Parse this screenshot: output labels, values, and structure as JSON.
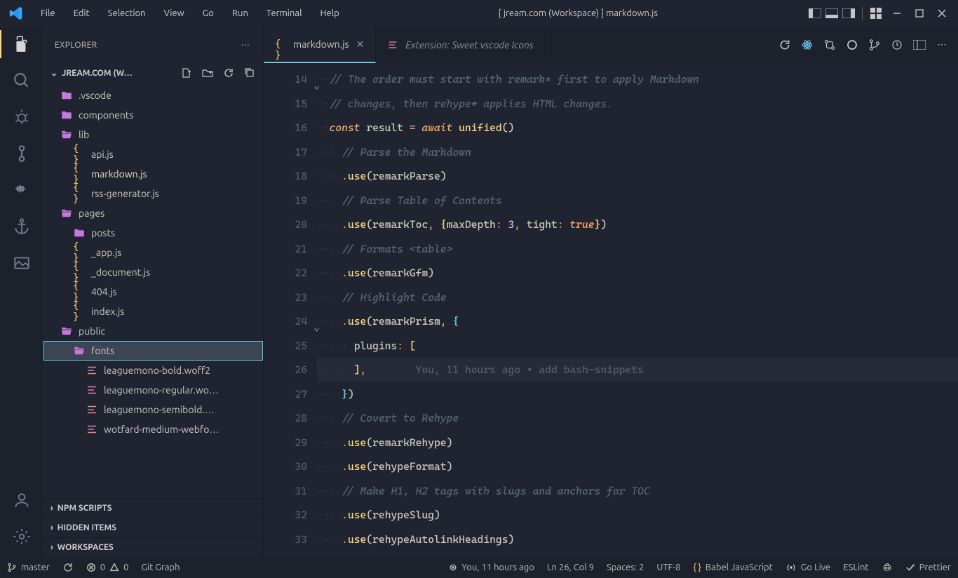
{
  "menu": [
    "File",
    "Edit",
    "Selection",
    "View",
    "Go",
    "Run",
    "Terminal",
    "Help"
  ],
  "window_title": "[ jream.com (Workspace) ] markdown.js",
  "sidebar": {
    "title": "EXPLORER",
    "workspace": "JREAM.COM (W…",
    "panels": [
      "NPM SCRIPTS",
      "HIDDEN ITEMS",
      "WORKSPACES"
    ]
  },
  "tree": [
    {
      "type": "folder",
      "depth": 0,
      "label": ".vscode",
      "open": false
    },
    {
      "type": "folder",
      "depth": 0,
      "label": "components",
      "open": false
    },
    {
      "type": "folder",
      "depth": 0,
      "label": "lib",
      "open": true
    },
    {
      "type": "file",
      "depth": 1,
      "label": "api.js",
      "kind": "js"
    },
    {
      "type": "file",
      "depth": 1,
      "label": "markdown.js",
      "kind": "js",
      "active": true
    },
    {
      "type": "file",
      "depth": 1,
      "label": "rss-generator.js",
      "kind": "js"
    },
    {
      "type": "folder",
      "depth": 0,
      "label": "pages",
      "open": true
    },
    {
      "type": "folder",
      "depth": 1,
      "label": "posts",
      "open": false
    },
    {
      "type": "file",
      "depth": 1,
      "label": "_app.js",
      "kind": "js"
    },
    {
      "type": "file",
      "depth": 1,
      "label": "_document.js",
      "kind": "js"
    },
    {
      "type": "file",
      "depth": 1,
      "label": "404.js",
      "kind": "js"
    },
    {
      "type": "file",
      "depth": 1,
      "label": "index.js",
      "kind": "js"
    },
    {
      "type": "folder",
      "depth": 0,
      "label": "public",
      "open": true
    },
    {
      "type": "folder",
      "depth": 1,
      "label": "fonts",
      "open": true,
      "selected": true
    },
    {
      "type": "file",
      "depth": 2,
      "label": "leaguemono-bold.woff2",
      "kind": "font"
    },
    {
      "type": "file",
      "depth": 2,
      "label": "leaguemono-regular.wo…",
      "kind": "font"
    },
    {
      "type": "file",
      "depth": 2,
      "label": "leaguemono-semibold.…",
      "kind": "font"
    },
    {
      "type": "file",
      "depth": 2,
      "label": "wotfard-medium-webfo…",
      "kind": "font"
    }
  ],
  "tabs": [
    {
      "label": "markdown.js",
      "kind": "js",
      "active": true,
      "pinned": false
    },
    {
      "label": "Extension: Sweet vscode Icons",
      "kind": "ext",
      "active": false
    }
  ],
  "code_start_line": 14,
  "code": {
    "blame_inline": "You, 11 hours ago • add bash-snippets",
    "lines": [
      {
        "n": 14,
        "fold": true,
        "t": [
          [
            "ws",
            "··"
          ],
          [
            "cm",
            "// The order must start with remark* first to apply Markdown"
          ]
        ]
      },
      {
        "n": 15,
        "t": [
          [
            "ws",
            "··"
          ],
          [
            "cm",
            "// changes, then rehype* applies HTML changes."
          ]
        ]
      },
      {
        "n": 16,
        "t": [
          [
            "ws",
            "··"
          ],
          [
            "kw",
            "const "
          ],
          [
            "var",
            "result "
          ],
          [
            "op",
            "= "
          ],
          [
            "kw",
            "await "
          ],
          [
            "fn",
            "unified"
          ],
          [
            "p",
            "("
          ],
          [
            "p",
            ")"
          ]
        ]
      },
      {
        "n": 17,
        "t": [
          [
            "ws",
            "··· "
          ],
          [
            "cm",
            "// Parse the Markdown"
          ]
        ]
      },
      {
        "n": 18,
        "t": [
          [
            "ws",
            "··· "
          ],
          [
            "op",
            "."
          ],
          [
            "fn",
            "use"
          ],
          [
            "p",
            "("
          ],
          [
            "var",
            "remarkParse"
          ],
          [
            "p",
            ")"
          ]
        ]
      },
      {
        "n": 19,
        "t": [
          [
            "ws",
            "··· "
          ],
          [
            "cm",
            "// Parse Table of Contents"
          ]
        ]
      },
      {
        "n": 20,
        "t": [
          [
            "ws",
            "··· "
          ],
          [
            "op",
            "."
          ],
          [
            "fn",
            "use"
          ],
          [
            "p",
            "("
          ],
          [
            "var",
            "remarkToc"
          ],
          [
            "op",
            ", "
          ],
          [
            "by",
            "{"
          ],
          [
            "prop",
            "maxDepth"
          ],
          [
            "op",
            ": "
          ],
          [
            "num",
            "3"
          ],
          [
            "op",
            ", "
          ],
          [
            "prop",
            "tight"
          ],
          [
            "op",
            ": "
          ],
          [
            "bool",
            "true"
          ],
          [
            "by",
            "}"
          ],
          [
            "p",
            ")"
          ]
        ]
      },
      {
        "n": 21,
        "t": [
          [
            "ws",
            "··· "
          ],
          [
            "cm",
            "// Formats <table>"
          ]
        ]
      },
      {
        "n": 22,
        "t": [
          [
            "ws",
            "··· "
          ],
          [
            "op",
            "."
          ],
          [
            "fn",
            "use"
          ],
          [
            "p",
            "("
          ],
          [
            "var",
            "remarkGfm"
          ],
          [
            "p",
            ")"
          ]
        ]
      },
      {
        "n": 23,
        "t": [
          [
            "ws",
            "··· "
          ],
          [
            "cm",
            "// Highlight Code"
          ]
        ]
      },
      {
        "n": 24,
        "fold": true,
        "t": [
          [
            "ws",
            "··· "
          ],
          [
            "op",
            "."
          ],
          [
            "fn",
            "use"
          ],
          [
            "p",
            "("
          ],
          [
            "var",
            "remarkPrism"
          ],
          [
            "op",
            ", "
          ],
          [
            "bb",
            "{"
          ]
        ]
      },
      {
        "n": 25,
        "t": [
          [
            "ws",
            "····· "
          ],
          [
            "prop",
            "plugins"
          ],
          [
            "op",
            ": "
          ],
          [
            "by",
            "["
          ]
        ]
      },
      {
        "n": 26,
        "hl": true,
        "t": [
          [
            "ws",
            "····· "
          ],
          [
            "by",
            "]"
          ],
          [
            "op",
            ","
          ],
          [
            "blame",
            "        You, 11 hours ago • add bash-snippets"
          ]
        ]
      },
      {
        "n": 27,
        "t": [
          [
            "ws",
            "··· "
          ],
          [
            "bb",
            "}"
          ],
          [
            "p",
            ")"
          ]
        ]
      },
      {
        "n": 28,
        "t": [
          [
            "ws",
            "··· "
          ],
          [
            "cm",
            "// Covert to Rehype"
          ]
        ]
      },
      {
        "n": 29,
        "t": [
          [
            "ws",
            "··· "
          ],
          [
            "op",
            "."
          ],
          [
            "fn",
            "use"
          ],
          [
            "p",
            "("
          ],
          [
            "var",
            "remarkRehype"
          ],
          [
            "p",
            ")"
          ]
        ]
      },
      {
        "n": 30,
        "t": [
          [
            "ws",
            "··· "
          ],
          [
            "op",
            "."
          ],
          [
            "fn",
            "use"
          ],
          [
            "p",
            "("
          ],
          [
            "var",
            "rehypeFormat"
          ],
          [
            "p",
            ")"
          ]
        ]
      },
      {
        "n": 31,
        "t": [
          [
            "ws",
            "··· "
          ],
          [
            "cm",
            "// Make H1, H2 tags with slugs and anchors for TOC"
          ]
        ]
      },
      {
        "n": 32,
        "t": [
          [
            "ws",
            "··· "
          ],
          [
            "op",
            "."
          ],
          [
            "fn",
            "use"
          ],
          [
            "p",
            "("
          ],
          [
            "var",
            "rehypeSlug"
          ],
          [
            "p",
            ")"
          ]
        ]
      },
      {
        "n": 33,
        "t": [
          [
            "ws",
            "··· "
          ],
          [
            "op",
            "."
          ],
          [
            "fn",
            "use"
          ],
          [
            "p",
            "("
          ],
          [
            "var",
            "rehypeAutolinkHeadings"
          ],
          [
            "p",
            ")"
          ]
        ]
      }
    ]
  },
  "status": {
    "branch": "master",
    "errors": "0",
    "warnings": "0",
    "git_graph": "Git Graph",
    "blame": "You, 11 hours ago",
    "position": "Ln 26, Col 9",
    "spaces": "Spaces: 2",
    "encoding": "UTF-8",
    "lang": "Babel JavaScript",
    "golive": "Go Live",
    "eslint": "ESLint",
    "prettier": "Prettier"
  }
}
